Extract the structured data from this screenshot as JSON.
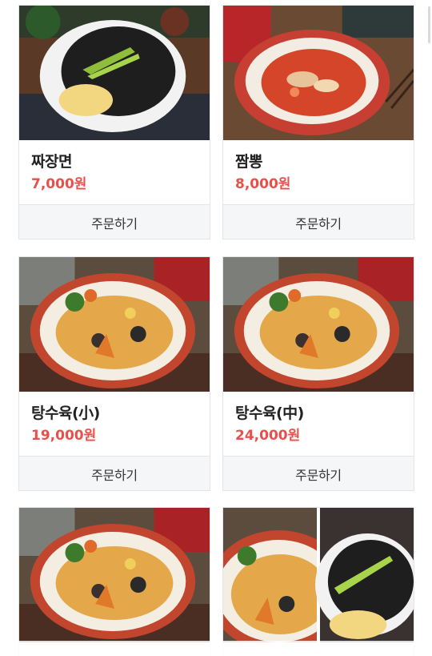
{
  "menu": {
    "items": [
      {
        "name": "짜장면",
        "price": "7,000원",
        "order_label": "주문하기",
        "photo": "jajangmyeon"
      },
      {
        "name": "짬뽕",
        "price": "8,000원",
        "order_label": "주문하기",
        "photo": "jjamppong"
      },
      {
        "name": "탕수육(小)",
        "price": "19,000원",
        "order_label": "주문하기",
        "photo": "tangsuyuk"
      },
      {
        "name": "탕수육(中)",
        "price": "24,000원",
        "order_label": "주문하기",
        "photo": "tangsuyuk"
      },
      {
        "photo": "tangsuyuk"
      },
      {
        "photo": "set-tangsuyuk-jajangmyeon"
      }
    ]
  },
  "colors": {
    "price": "#e8504b",
    "button_bg": "#f5f6f8",
    "border": "#e3e5e8"
  }
}
